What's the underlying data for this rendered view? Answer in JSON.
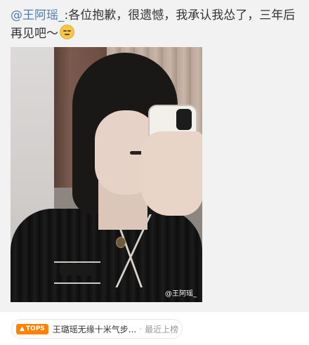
{
  "post": {
    "mention": "@王阿瑶_",
    "text": ":各位抱歉，很遗憾，我承认我怂了，三年后再见吧～",
    "emoji": "smile-emoji"
  },
  "photo": {
    "watermark": "@王阿瑶_"
  },
  "hot_topic": {
    "tag_label": "TOPS",
    "title": "王璐瑶无缘十米气步...",
    "separator": "·",
    "subtitle": "最近上榜",
    "accent": "#ff8200"
  }
}
